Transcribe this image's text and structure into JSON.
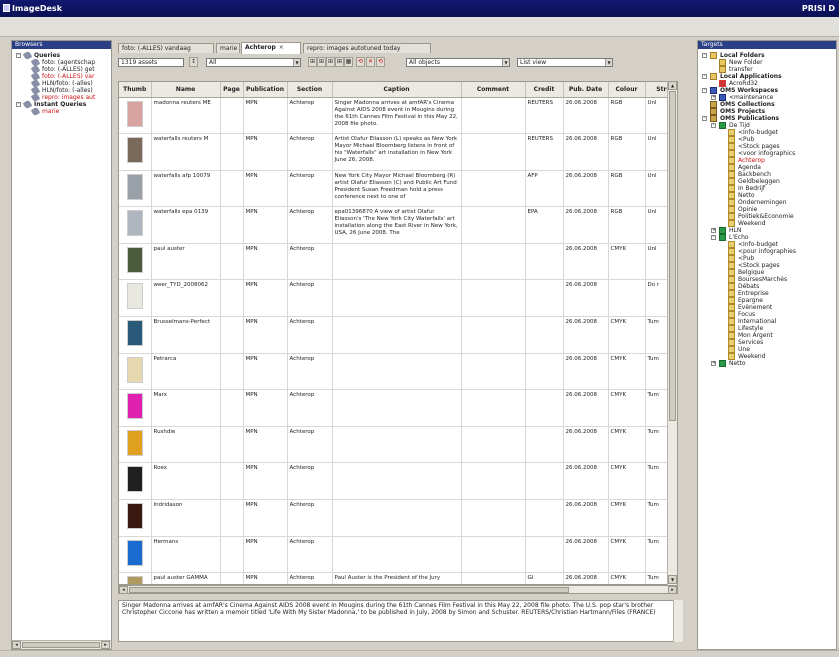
{
  "window": {
    "title": "ImageDesk",
    "product": "PRISI D"
  },
  "browsers": {
    "header": "Browsers",
    "items": [
      {
        "label": "Queries",
        "level": 0,
        "bold": true,
        "red": false,
        "icon": "query-icon",
        "expander": "-"
      },
      {
        "label": "foto: (agentschap",
        "level": 1,
        "bold": false,
        "red": false,
        "icon": "query-icon"
      },
      {
        "label": "foto: (-ALLES) get",
        "level": 1,
        "bold": false,
        "red": false,
        "icon": "query-icon"
      },
      {
        "label": "foto: (-ALLES) var",
        "level": 1,
        "bold": false,
        "red": true,
        "icon": "query-icon"
      },
      {
        "label": "HLN/foto: (-alles)",
        "level": 1,
        "bold": false,
        "red": false,
        "icon": "query-icon"
      },
      {
        "label": "HLN/foto: (-alles)",
        "level": 1,
        "bold": false,
        "red": false,
        "icon": "query-icon"
      },
      {
        "label": "repro: images aut",
        "level": 1,
        "bold": false,
        "red": true,
        "icon": "query-icon"
      },
      {
        "label": "Instant Queries",
        "level": 0,
        "bold": true,
        "red": false,
        "icon": "query-icon",
        "expander": "-"
      },
      {
        "label": "marie",
        "level": 1,
        "bold": false,
        "red": true,
        "icon": "query-icon"
      }
    ]
  },
  "tabs": [
    {
      "label": "foto: (-ALLES) vandaag",
      "active": false
    },
    {
      "label": "marie",
      "active": false
    },
    {
      "label": "Achterop",
      "active": true,
      "close": "×"
    },
    {
      "label": "repro: images autotuned today",
      "active": false
    }
  ],
  "toolbar": {
    "asset_count": "1319 assets",
    "filter1": "All",
    "objects_filter": "All objects",
    "view_mode": "List view",
    "buttons": [
      "⊞",
      "⊞",
      "⊞",
      "⊞",
      "▦",
      "⟲",
      "✕",
      "⟲"
    ]
  },
  "grid": {
    "columns": [
      "Thumb",
      "Name",
      "Page",
      "Publication",
      "Section",
      "Caption",
      "Comment",
      "Credit",
      "Pub. Date",
      "Colour",
      "Stru"
    ],
    "rows": [
      {
        "name": "madonna reuters ME",
        "page": "",
        "publication": "MPN",
        "section": "Achterop",
        "caption": "Singer Madonna arrives at amfAR's Cinema Against AIDS 2008 event in Mougins during the 61th Cannes Film Festival in this May 22, 2008 file photo.",
        "comment": "",
        "credit": "REUTERS",
        "pubdate": "26.06.2008",
        "colour": "RGB",
        "stru": "Unl",
        "thumb": "#d9a4a0"
      },
      {
        "name": "waterfalls reuters M",
        "page": "",
        "publication": "MPN",
        "section": "Achterop",
        "caption": "Artist Olafur Eliasson (L) speaks as New York Mayor Michael Bloomberg listens in front of his \"Waterfalls\" art installation in New York June 26, 2008.",
        "comment": "",
        "credit": "REUTERS",
        "pubdate": "26.06.2008",
        "colour": "RGB",
        "stru": "Unl",
        "thumb": "#7a6a5a"
      },
      {
        "name": "waterfalls afp 10079",
        "page": "",
        "publication": "MPN",
        "section": "Achterop",
        "caption": "New York City Mayor Michael Bloomberg (R) artist Olafur Eliasson (C) and Public Art Fund President Susan Freedman hold a press conference next to one of",
        "comment": "",
        "credit": "AFP",
        "pubdate": "26.06.2008",
        "colour": "RGB",
        "stru": "Unl",
        "thumb": "#9aa0a8"
      },
      {
        "name": "waterfalls epa 0139",
        "page": "",
        "publication": "MPN",
        "section": "Achterop",
        "caption": "epa01396870 A view of artist Olafur Eliasson's 'The New York City Waterfalls' art installation along the East River in New York, USA, 26 June 2008. The",
        "comment": "",
        "credit": "EPA",
        "pubdate": "26.06.2008",
        "colour": "RGB",
        "stru": "Unl",
        "thumb": "#b0b6c0"
      },
      {
        "name": "paul auster",
        "page": "",
        "publication": "MPN",
        "section": "Achterop",
        "caption": "",
        "comment": "",
        "credit": "",
        "pubdate": "26.06.2008",
        "colour": "CMYK",
        "stru": "Unl",
        "thumb": "#4a5a3a"
      },
      {
        "name": "weer_TYD_2008062",
        "page": "",
        "publication": "MPN",
        "section": "Achterop",
        "caption": "",
        "comment": "",
        "credit": "",
        "pubdate": "26.06.2008",
        "colour": "",
        "stru": "Do r",
        "thumb": "#e8e8e0"
      },
      {
        "name": "Brusselmans-Perfect",
        "page": "",
        "publication": "MPN",
        "section": "Achterop",
        "caption": "",
        "comment": "",
        "credit": "",
        "pubdate": "26.06.2008",
        "colour": "CMYK",
        "stru": "Tum",
        "thumb": "#2a5a7a"
      },
      {
        "name": "Petrarca",
        "page": "",
        "publication": "MPN",
        "section": "Achterop",
        "caption": "",
        "comment": "",
        "credit": "",
        "pubdate": "26.06.2008",
        "colour": "CMYK",
        "stru": "Tum",
        "thumb": "#e8d8b0"
      },
      {
        "name": "Marx",
        "page": "",
        "publication": "MPN",
        "section": "Achterop",
        "caption": "",
        "comment": "",
        "credit": "",
        "pubdate": "26.06.2008",
        "colour": "CMYK",
        "stru": "Tum",
        "thumb": "#e020b0"
      },
      {
        "name": "Rushdie",
        "page": "",
        "publication": "MPN",
        "section": "Achterop",
        "caption": "",
        "comment": "",
        "credit": "",
        "pubdate": "26.06.2008",
        "colour": "CMYK",
        "stru": "Tum",
        "thumb": "#e0a020"
      },
      {
        "name": "Roex",
        "page": "",
        "publication": "MPN",
        "section": "Achterop",
        "caption": "",
        "comment": "",
        "credit": "",
        "pubdate": "26.06.2008",
        "colour": "CMYK",
        "stru": "Tum",
        "thumb": "#202020"
      },
      {
        "name": "Indridason",
        "page": "",
        "publication": "MPN",
        "section": "Achterop",
        "caption": "",
        "comment": "",
        "credit": "",
        "pubdate": "26.06.2008",
        "colour": "CMYK",
        "stru": "Tum",
        "thumb": "#3a1a10"
      },
      {
        "name": "Hermans",
        "page": "",
        "publication": "MPN",
        "section": "Achterop",
        "caption": "",
        "comment": "",
        "credit": "",
        "pubdate": "26.06.2008",
        "colour": "CMYK",
        "stru": "Tum",
        "thumb": "#1a6ad0"
      },
      {
        "name": "paul auster GAMMA",
        "page": "",
        "publication": "MPN",
        "section": "Achterop",
        "caption": "Paul Auster is the President of the Jury",
        "comment": "",
        "credit": "GI",
        "pubdate": "26.06.2008",
        "colour": "CMYK",
        "stru": "Tum",
        "thumb": "#b09a60"
      }
    ]
  },
  "caption_text": "Singer Madonna arrives at amfAR's Cinema Against AIDS 2008 event in Mougins during the 61th Cannes Film Festival in this May 22, 2008 file photo. The U.S. pop star's brother Christopher Ciccone has written a memoir titled 'Life With My Sister Madonna,' to be published in July, 2008 by Simon and Schuster. REUTERS/Christian Hartmann/Files (FRANCE)",
  "targets": {
    "header": "Targets",
    "items": [
      {
        "label": "Local Folders",
        "level": 0,
        "bold": true,
        "red": false,
        "icon": "folder-icon",
        "expander": "-"
      },
      {
        "label": "New Folder",
        "level": 1,
        "bold": false,
        "red": false,
        "icon": "folder-icon"
      },
      {
        "label": "transfer",
        "level": 1,
        "bold": false,
        "red": false,
        "icon": "folder-icon"
      },
      {
        "label": "Local Applications",
        "level": 0,
        "bold": true,
        "red": false,
        "icon": "folder-icon",
        "expander": "-"
      },
      {
        "label": "AcroRd32",
        "level": 1,
        "bold": false,
        "red": false,
        "icon": "app-icon"
      },
      {
        "label": "OMS Workspaces",
        "level": 0,
        "bold": true,
        "red": false,
        "icon": "workspace-icon",
        "expander": "-"
      },
      {
        "label": "<maintenance",
        "level": 1,
        "bold": false,
        "red": false,
        "icon": "workspace-icon",
        "expander": "+"
      },
      {
        "label": "OMS Collections",
        "level": 0,
        "bold": true,
        "red": false,
        "icon": "collection-icon"
      },
      {
        "label": "OMS Projects",
        "level": 0,
        "bold": true,
        "red": false,
        "icon": "collection-icon"
      },
      {
        "label": "OMS Publications",
        "level": 0,
        "bold": true,
        "red": false,
        "icon": "collection-icon",
        "expander": "-"
      },
      {
        "label": "De Tijd",
        "level": 1,
        "bold": false,
        "red": false,
        "icon": "publication-icon",
        "expander": "-"
      },
      {
        "label": "<Info-budget",
        "level": 2,
        "bold": false,
        "red": false,
        "icon": "section-icon"
      },
      {
        "label": "<Pub",
        "level": 2,
        "bold": false,
        "red": false,
        "icon": "section-icon"
      },
      {
        "label": "<Stock pages",
        "level": 2,
        "bold": false,
        "red": false,
        "icon": "section-icon"
      },
      {
        "label": "<voor infographics",
        "level": 2,
        "bold": false,
        "red": false,
        "icon": "section-icon"
      },
      {
        "label": "Achterop",
        "level": 2,
        "bold": false,
        "red": true,
        "icon": "section-icon"
      },
      {
        "label": "Agenda",
        "level": 2,
        "bold": false,
        "red": false,
        "icon": "section-icon"
      },
      {
        "label": "Backbench",
        "level": 2,
        "bold": false,
        "red": false,
        "icon": "section-icon"
      },
      {
        "label": "Geldbeleggen",
        "level": 2,
        "bold": false,
        "red": false,
        "icon": "section-icon"
      },
      {
        "label": "In Bedrijf",
        "level": 2,
        "bold": false,
        "red": false,
        "icon": "section-icon"
      },
      {
        "label": "Netto",
        "level": 2,
        "bold": false,
        "red": false,
        "icon": "section-icon"
      },
      {
        "label": "Ondernemingen",
        "level": 2,
        "bold": false,
        "red": false,
        "icon": "section-icon"
      },
      {
        "label": "Opinie",
        "level": 2,
        "bold": false,
        "red": false,
        "icon": "section-icon"
      },
      {
        "label": "Politiek&Economie",
        "level": 2,
        "bold": false,
        "red": false,
        "icon": "section-icon"
      },
      {
        "label": "Weekend",
        "level": 2,
        "bold": false,
        "red": false,
        "icon": "section-icon"
      },
      {
        "label": "HLN",
        "level": 1,
        "bold": false,
        "red": false,
        "icon": "publication-icon",
        "expander": "+"
      },
      {
        "label": "L'Echo",
        "level": 1,
        "bold": false,
        "red": false,
        "icon": "publication-icon",
        "expander": "-"
      },
      {
        "label": "<Info-budget",
        "level": 2,
        "bold": false,
        "red": false,
        "icon": "section-icon"
      },
      {
        "label": "<pour infographies",
        "level": 2,
        "bold": false,
        "red": false,
        "icon": "section-icon"
      },
      {
        "label": "<Pub",
        "level": 2,
        "bold": false,
        "red": false,
        "icon": "section-icon"
      },
      {
        "label": "<Stock pages",
        "level": 2,
        "bold": false,
        "red": false,
        "icon": "section-icon"
      },
      {
        "label": "Belgique",
        "level": 2,
        "bold": false,
        "red": false,
        "icon": "section-icon"
      },
      {
        "label": "BoursesMarchés",
        "level": 2,
        "bold": false,
        "red": false,
        "icon": "section-icon"
      },
      {
        "label": "Débats",
        "level": 2,
        "bold": false,
        "red": false,
        "icon": "section-icon"
      },
      {
        "label": "Entreprise",
        "level": 2,
        "bold": false,
        "red": false,
        "icon": "section-icon"
      },
      {
        "label": "Epargne",
        "level": 2,
        "bold": false,
        "red": false,
        "icon": "section-icon"
      },
      {
        "label": "Evènement",
        "level": 2,
        "bold": false,
        "red": false,
        "icon": "section-icon"
      },
      {
        "label": "Focus",
        "level": 2,
        "bold": false,
        "red": false,
        "icon": "section-icon"
      },
      {
        "label": "International",
        "level": 2,
        "bold": false,
        "red": false,
        "icon": "section-icon"
      },
      {
        "label": "Lifestyle",
        "level": 2,
        "bold": false,
        "red": false,
        "icon": "section-icon"
      },
      {
        "label": "Mon Argent",
        "level": 2,
        "bold": false,
        "red": false,
        "icon": "section-icon"
      },
      {
        "label": "Services",
        "level": 2,
        "bold": false,
        "red": false,
        "icon": "section-icon"
      },
      {
        "label": "Une",
        "level": 2,
        "bold": false,
        "red": false,
        "icon": "section-icon"
      },
      {
        "label": "Weekend",
        "level": 2,
        "bold": false,
        "red": false,
        "icon": "section-icon"
      },
      {
        "label": "Netto",
        "level": 1,
        "bold": false,
        "red": false,
        "icon": "publication-icon",
        "expander": "+"
      }
    ]
  }
}
